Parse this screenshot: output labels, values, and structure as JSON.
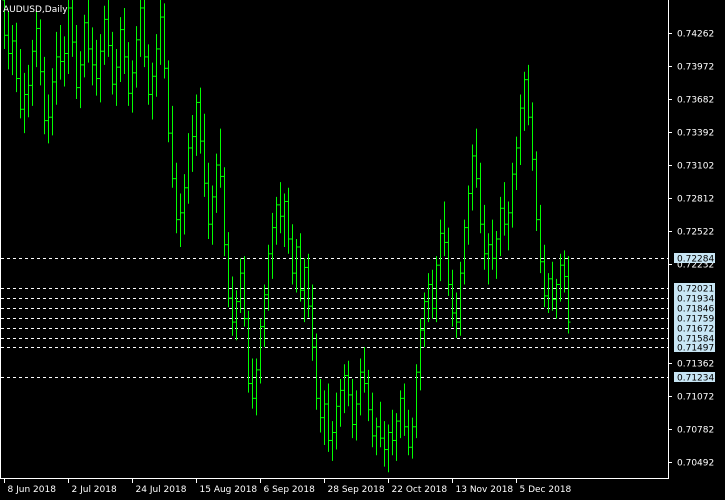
{
  "chart_data": {
    "type": "bar",
    "title": "AUDUSD,Daily",
    "style": "ohlc-bars",
    "colors": {
      "background": "#000000",
      "bars": "#00ff00",
      "frame": "#ffffff",
      "grid_lines": "#ffffff",
      "price_tag_fill": "#c8e6f5",
      "text": "#ffffff"
    },
    "ylim": [
      0.7035,
      0.7455
    ],
    "y_ticks": [
      "0.74262",
      "0.73972",
      "0.73682",
      "0.73392",
      "0.73102",
      "0.72812",
      "0.72522",
      "0.72232",
      "0.71362",
      "0.71072",
      "0.70782",
      "0.70492"
    ],
    "x_ticks": [
      "8 Jun 2018",
      "2 Jul 2018",
      "24 Jul 2018",
      "15 Aug 2018",
      "6 Sep 2018",
      "28 Sep 2018",
      "22 Oct 2018",
      "13 Nov 2018",
      "5 Dec 2018"
    ],
    "x_tick_bar_index": [
      0,
      16,
      32,
      48,
      64,
      80,
      96,
      112,
      128
    ],
    "horizontal_levels": [
      "0.72284",
      "0.72021",
      "0.71934",
      "0.71846",
      "0.71759",
      "0.71672",
      "0.71584",
      "0.71497",
      "0.71234"
    ],
    "levels_with_price_tags": [
      "0.72284",
      "0.72021",
      "0.71934",
      "0.71846",
      "0.71759",
      "0.71672",
      "0.71584",
      "0.71497",
      "0.71234"
    ],
    "series": [
      {
        "values_ohlc": [
          [
            0.7455,
            0.7461,
            0.7412,
            0.7424
          ],
          [
            0.7424,
            0.7445,
            0.7394,
            0.7408
          ],
          [
            0.7408,
            0.7433,
            0.7389,
            0.7419
          ],
          [
            0.7419,
            0.7435,
            0.7374,
            0.7386
          ],
          [
            0.7386,
            0.7412,
            0.7351,
            0.7359
          ],
          [
            0.7359,
            0.7391,
            0.7338,
            0.7372
          ],
          [
            0.7372,
            0.7398,
            0.7352,
            0.738
          ],
          [
            0.738,
            0.742,
            0.7362,
            0.741
          ],
          [
            0.741,
            0.7445,
            0.7396,
            0.743
          ],
          [
            0.743,
            0.7438,
            0.738,
            0.7392
          ],
          [
            0.7392,
            0.7405,
            0.7337,
            0.7349
          ],
          [
            0.7349,
            0.7372,
            0.7329,
            0.7352
          ],
          [
            0.7352,
            0.7395,
            0.7336,
            0.7383
          ],
          [
            0.7383,
            0.7427,
            0.7363,
            0.7405
          ],
          [
            0.7405,
            0.7433,
            0.7385,
            0.7401
          ],
          [
            0.7401,
            0.7423,
            0.7379,
            0.7408
          ],
          [
            0.7408,
            0.7461,
            0.739,
            0.7448
          ],
          [
            0.7448,
            0.7461,
            0.7405,
            0.7418
          ],
          [
            0.7418,
            0.7433,
            0.7368,
            0.7378
          ],
          [
            0.7378,
            0.741,
            0.736,
            0.7398
          ],
          [
            0.7398,
            0.7442,
            0.7387,
            0.7435
          ],
          [
            0.7435,
            0.7455,
            0.74,
            0.7412
          ],
          [
            0.7412,
            0.7431,
            0.738,
            0.7398
          ],
          [
            0.7398,
            0.742,
            0.7371,
            0.7386
          ],
          [
            0.7386,
            0.7425,
            0.7365,
            0.741
          ],
          [
            0.741,
            0.745,
            0.7398,
            0.7438
          ],
          [
            0.7438,
            0.7461,
            0.7405,
            0.7415
          ],
          [
            0.7415,
            0.7427,
            0.7372,
            0.7381
          ],
          [
            0.7381,
            0.7412,
            0.7362,
            0.7396
          ],
          [
            0.7396,
            0.744,
            0.7383,
            0.7429
          ],
          [
            0.7429,
            0.7448,
            0.739,
            0.7405
          ],
          [
            0.7405,
            0.7418,
            0.7362,
            0.7373
          ],
          [
            0.7373,
            0.7402,
            0.7356,
            0.7391
          ],
          [
            0.7391,
            0.7432,
            0.7378,
            0.742
          ],
          [
            0.742,
            0.7461,
            0.7405,
            0.7448
          ],
          [
            0.7448,
            0.7461,
            0.7396,
            0.7405
          ],
          [
            0.7405,
            0.7416,
            0.7363,
            0.7372
          ],
          [
            0.7372,
            0.74,
            0.735,
            0.7388
          ],
          [
            0.7388,
            0.7425,
            0.737,
            0.7412
          ],
          [
            0.7412,
            0.7456,
            0.7398,
            0.744
          ],
          [
            0.744,
            0.7452,
            0.7386,
            0.7395
          ],
          [
            0.7395,
            0.7402,
            0.733,
            0.7338
          ],
          [
            0.7338,
            0.7362,
            0.729,
            0.7298
          ],
          [
            0.7298,
            0.7312,
            0.725,
            0.7262
          ],
          [
            0.7262,
            0.7285,
            0.7238,
            0.7268
          ],
          [
            0.7268,
            0.7302,
            0.7249,
            0.729
          ],
          [
            0.729,
            0.7338,
            0.7276,
            0.7325
          ],
          [
            0.7325,
            0.7354,
            0.7304,
            0.7335
          ],
          [
            0.7335,
            0.7372,
            0.7318,
            0.7365
          ],
          [
            0.7365,
            0.7378,
            0.732,
            0.7331
          ],
          [
            0.7331,
            0.7355,
            0.7282,
            0.7294
          ],
          [
            0.7294,
            0.7312,
            0.7245,
            0.7258
          ],
          [
            0.7258,
            0.7292,
            0.724,
            0.7282
          ],
          [
            0.7282,
            0.732,
            0.7268,
            0.731
          ],
          [
            0.731,
            0.7342,
            0.729,
            0.73
          ],
          [
            0.73,
            0.7308,
            0.723,
            0.724
          ],
          [
            0.724,
            0.7251,
            0.7185,
            0.7193
          ],
          [
            0.7193,
            0.7212,
            0.716,
            0.7172
          ],
          [
            0.7172,
            0.72,
            0.7156,
            0.719
          ],
          [
            0.719,
            0.7228,
            0.718,
            0.7215
          ],
          [
            0.7215,
            0.723,
            0.7168,
            0.7175
          ],
          [
            0.7175,
            0.7182,
            0.711,
            0.7118
          ],
          [
            0.7118,
            0.714,
            0.7096,
            0.7105
          ],
          [
            0.7105,
            0.714,
            0.709,
            0.713
          ],
          [
            0.713,
            0.7175,
            0.7118,
            0.7168
          ],
          [
            0.7168,
            0.7205,
            0.715,
            0.7196
          ],
          [
            0.7196,
            0.724,
            0.7182,
            0.7232
          ],
          [
            0.7232,
            0.7268,
            0.721,
            0.7255
          ],
          [
            0.7255,
            0.7282,
            0.724,
            0.7275
          ],
          [
            0.7275,
            0.7295,
            0.725,
            0.7265
          ],
          [
            0.7265,
            0.7285,
            0.7238,
            0.7278
          ],
          [
            0.7278,
            0.729,
            0.7232,
            0.7245
          ],
          [
            0.7245,
            0.7258,
            0.7205,
            0.7215
          ],
          [
            0.7215,
            0.7245,
            0.7198,
            0.7238
          ],
          [
            0.7238,
            0.725,
            0.719,
            0.72
          ],
          [
            0.72,
            0.7228,
            0.7172,
            0.722
          ],
          [
            0.722,
            0.7232,
            0.7176,
            0.7186
          ],
          [
            0.7186,
            0.7205,
            0.7138,
            0.715
          ],
          [
            0.715,
            0.7162,
            0.7095,
            0.7105
          ],
          [
            0.7105,
            0.7122,
            0.7075,
            0.7088
          ],
          [
            0.7088,
            0.7112,
            0.7064,
            0.71
          ],
          [
            0.71,
            0.7118,
            0.7058,
            0.7068
          ],
          [
            0.7068,
            0.7085,
            0.705,
            0.7075
          ],
          [
            0.7075,
            0.711,
            0.706,
            0.7098
          ],
          [
            0.7098,
            0.7122,
            0.708,
            0.7112
          ],
          [
            0.7112,
            0.7135,
            0.7092,
            0.7125
          ],
          [
            0.7125,
            0.7138,
            0.7098,
            0.7108
          ],
          [
            0.7108,
            0.7122,
            0.707,
            0.7082
          ],
          [
            0.7082,
            0.7112,
            0.7068,
            0.71
          ],
          [
            0.71,
            0.714,
            0.709,
            0.7128
          ],
          [
            0.7128,
            0.715,
            0.711,
            0.7118
          ],
          [
            0.7118,
            0.713,
            0.7085,
            0.7095
          ],
          [
            0.7095,
            0.711,
            0.7062,
            0.7072
          ],
          [
            0.7072,
            0.7088,
            0.7055,
            0.708
          ],
          [
            0.708,
            0.7102,
            0.7062,
            0.707
          ],
          [
            0.707,
            0.7085,
            0.7045,
            0.706
          ],
          [
            0.706,
            0.7082,
            0.704,
            0.7075
          ],
          [
            0.7075,
            0.7095,
            0.7055,
            0.7068
          ],
          [
            0.7068,
            0.7092,
            0.705,
            0.7085
          ],
          [
            0.7085,
            0.7112,
            0.707,
            0.7105
          ],
          [
            0.7105,
            0.7118,
            0.7072,
            0.708
          ],
          [
            0.708,
            0.7095,
            0.7055,
            0.7062
          ],
          [
            0.7062,
            0.7088,
            0.7052,
            0.708
          ],
          [
            0.708,
            0.7135,
            0.707,
            0.7128
          ],
          [
            0.7128,
            0.7175,
            0.7112,
            0.7165
          ],
          [
            0.7165,
            0.7198,
            0.715,
            0.719
          ],
          [
            0.719,
            0.7215,
            0.7172,
            0.7205
          ],
          [
            0.7205,
            0.7218,
            0.7175,
            0.7184
          ],
          [
            0.7184,
            0.723,
            0.7172,
            0.7222
          ],
          [
            0.7222,
            0.7262,
            0.7208,
            0.725
          ],
          [
            0.725,
            0.7278,
            0.723,
            0.7242
          ],
          [
            0.7242,
            0.7255,
            0.7195,
            0.7205
          ],
          [
            0.7205,
            0.7218,
            0.7168,
            0.718
          ],
          [
            0.718,
            0.7198,
            0.7158,
            0.7172
          ],
          [
            0.7172,
            0.7225,
            0.716,
            0.7215
          ],
          [
            0.7215,
            0.7262,
            0.7205,
            0.7255
          ],
          [
            0.7255,
            0.7292,
            0.724,
            0.7285
          ],
          [
            0.7285,
            0.7328,
            0.727,
            0.7318
          ],
          [
            0.7318,
            0.7342,
            0.729,
            0.7298
          ],
          [
            0.7298,
            0.7312,
            0.725,
            0.7258
          ],
          [
            0.7258,
            0.7275,
            0.7218,
            0.7232
          ],
          [
            0.7232,
            0.725,
            0.7205,
            0.724
          ],
          [
            0.724,
            0.7262,
            0.7218,
            0.7228
          ],
          [
            0.7228,
            0.7252,
            0.721,
            0.7245
          ],
          [
            0.7245,
            0.7282,
            0.723,
            0.7272
          ],
          [
            0.7272,
            0.7295,
            0.7248,
            0.7258
          ],
          [
            0.7258,
            0.7278,
            0.7235,
            0.7268
          ],
          [
            0.7268,
            0.7312,
            0.7255,
            0.7302
          ],
          [
            0.7302,
            0.7335,
            0.7288,
            0.7325
          ],
          [
            0.7325,
            0.7372,
            0.731,
            0.736
          ],
          [
            0.736,
            0.7392,
            0.734,
            0.7385
          ],
          [
            0.7385,
            0.7398,
            0.7345,
            0.7352
          ],
          [
            0.7352,
            0.7365,
            0.7305,
            0.7315
          ],
          [
            0.7315,
            0.7322,
            0.7252,
            0.7262
          ],
          [
            0.7262,
            0.7275,
            0.7215,
            0.7225
          ],
          [
            0.7225,
            0.724,
            0.7185,
            0.7195
          ],
          [
            0.7195,
            0.7215,
            0.718,
            0.721
          ],
          [
            0.721,
            0.7225,
            0.7182,
            0.7192
          ],
          [
            0.7192,
            0.721,
            0.7175,
            0.7205
          ],
          [
            0.7205,
            0.7232,
            0.719,
            0.7222
          ],
          [
            0.7222,
            0.7235,
            0.7198,
            0.7212
          ],
          [
            0.7212,
            0.723,
            0.7162,
            0.7172
          ]
        ]
      }
    ]
  }
}
